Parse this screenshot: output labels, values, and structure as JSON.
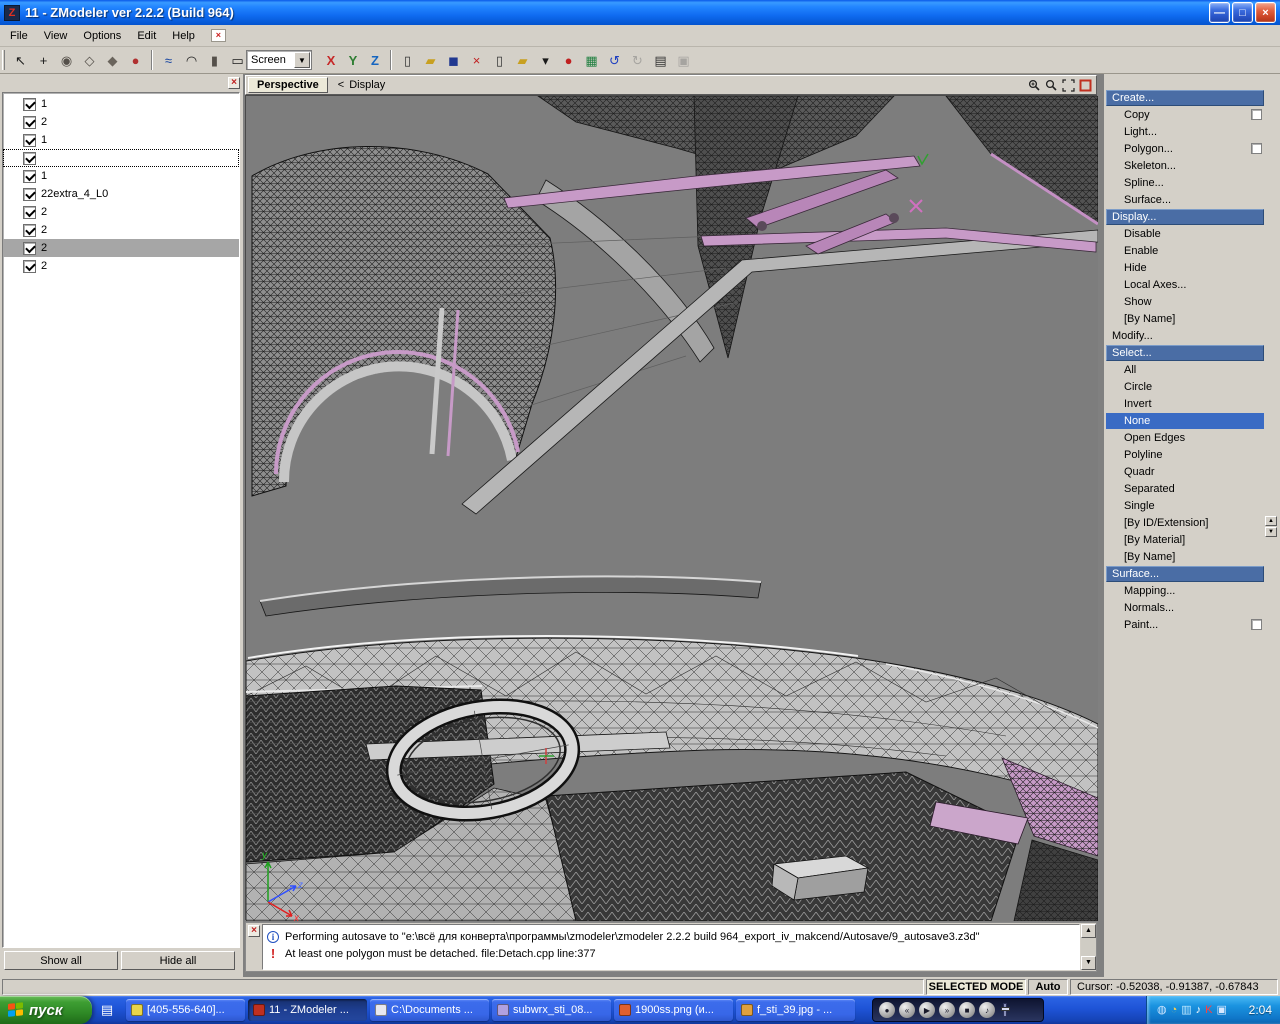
{
  "window": {
    "title": "11 - ZModeler ver 2.2.2 (Build 964)",
    "app_icon_letter": "Z",
    "controls": {
      "minimize": "—",
      "maximize": "□",
      "close": "×"
    }
  },
  "menubar": {
    "items": [
      "File",
      "View",
      "Options",
      "Edit",
      "Help"
    ],
    "decor_glyph": "×"
  },
  "toolbar": {
    "screen_label": "Screen",
    "screen_dropdown_glyph": "▼",
    "axis": [
      {
        "label": "X",
        "color": "#C62828"
      },
      {
        "label": "Y",
        "color": "#2E7D32"
      },
      {
        "label": "Z",
        "color": "#1565C0"
      }
    ],
    "group_a": [
      {
        "name": "select-tool-icon",
        "glyph": "↖",
        "color": "#1a1a1a"
      },
      {
        "name": "move-tool-icon",
        "glyph": "+",
        "color": "#1a1a1a"
      },
      {
        "name": "figure-tool-icon",
        "glyph": "◉",
        "color": "#55504a"
      },
      {
        "name": "bone-tool-icon",
        "glyph": "◇",
        "color": "#55504a"
      },
      {
        "name": "joint-tool-icon",
        "glyph": "◆",
        "color": "#6a645c"
      },
      {
        "name": "sphere-primitive-icon",
        "glyph": "●",
        "color": "#B03030"
      }
    ],
    "group_b": [
      {
        "name": "polyline-tool-icon",
        "glyph": "≈",
        "color": "#1040A0"
      },
      {
        "name": "arc-tool-icon",
        "glyph": "◠",
        "color": "#1a1a1a"
      },
      {
        "name": "cylinder-primitive-icon",
        "glyph": "▮",
        "color": "#55504a"
      },
      {
        "name": "box-primitive-icon",
        "glyph": "▭",
        "color": "#1a1a1a"
      },
      {
        "name": "primitives-dropdown-icon",
        "glyph": "▾",
        "color": "#1a1a1a"
      }
    ],
    "group_c": [
      {
        "name": "new-file-icon",
        "glyph": "▯",
        "color": "#333333"
      },
      {
        "name": "open-file-icon",
        "glyph": "▰",
        "color": "#C8A020"
      },
      {
        "name": "save-file-icon",
        "glyph": "◼",
        "color": "#203890"
      },
      {
        "name": "delete-icon",
        "glyph": "×",
        "color": "#C02020"
      },
      {
        "name": "export-file-icon",
        "glyph": "▯",
        "color": "#333333"
      },
      {
        "name": "import-folder-icon",
        "glyph": "▰",
        "color": "#C8A020"
      },
      {
        "name": "import-dropdown-icon",
        "glyph": "▾",
        "color": "#1a1a1a"
      },
      {
        "name": "record-icon",
        "glyph": "●",
        "color": "#C02020"
      },
      {
        "name": "image-tool-icon",
        "glyph": "▦",
        "color": "#208040"
      },
      {
        "name": "undo-icon",
        "glyph": "↺",
        "color": "#2040C0"
      },
      {
        "name": "redo-icon",
        "glyph": "↻",
        "color": "#707070",
        "disabled": true
      },
      {
        "name": "notes-icon",
        "glyph": "▤",
        "color": "#333333"
      },
      {
        "name": "repeat-icon",
        "glyph": "▣",
        "color": "#707070",
        "disabled": true
      }
    ]
  },
  "left_panel": {
    "items": [
      {
        "label": "1",
        "checked": true,
        "state": "normal"
      },
      {
        "label": "2",
        "checked": true,
        "state": "normal"
      },
      {
        "label": "1",
        "checked": true,
        "state": "normal"
      },
      {
        "label": "",
        "checked": true,
        "state": "focused"
      },
      {
        "label": "1",
        "checked": true,
        "state": "normal"
      },
      {
        "label": "22extra_4_L0",
        "checked": true,
        "state": "normal"
      },
      {
        "label": "2",
        "checked": true,
        "state": "normal"
      },
      {
        "label": "2",
        "checked": true,
        "state": "normal"
      },
      {
        "label": "2",
        "checked": true,
        "state": "selected"
      },
      {
        "label": "2",
        "checked": true,
        "state": "normal"
      }
    ],
    "show_all_button": "Show all",
    "hide_all_button": "Hide all"
  },
  "viewport": {
    "tab_label": "Perspective",
    "back_glyph": "<",
    "display_label": "Display",
    "axis_x": "x",
    "axis_y": "y",
    "axis_z": "z"
  },
  "right_menu": {
    "items": [
      {
        "label": "Create...",
        "type": "header"
      },
      {
        "label": "Copy",
        "type": "item",
        "checkbox": true
      },
      {
        "label": "Light...",
        "type": "item"
      },
      {
        "label": "Polygon...",
        "type": "item",
        "checkbox": true
      },
      {
        "label": "Skeleton...",
        "type": "item"
      },
      {
        "label": "Spline...",
        "type": "item"
      },
      {
        "label": "Surface...",
        "type": "item"
      },
      {
        "label": "Display...",
        "type": "header"
      },
      {
        "label": "Disable",
        "type": "item"
      },
      {
        "label": "Enable",
        "type": "item"
      },
      {
        "label": "Hide",
        "type": "item"
      },
      {
        "label": "Local Axes...",
        "type": "item"
      },
      {
        "label": "Show",
        "type": "item"
      },
      {
        "label": "[By Name]",
        "type": "item"
      },
      {
        "label": "Modify...",
        "type": "plain"
      },
      {
        "label": "Select...",
        "type": "header"
      },
      {
        "label": "All",
        "type": "item"
      },
      {
        "label": "Circle",
        "type": "item"
      },
      {
        "label": "Invert",
        "type": "item"
      },
      {
        "label": "None",
        "type": "item",
        "selected": true
      },
      {
        "label": "Open Edges",
        "type": "item"
      },
      {
        "label": "Polyline",
        "type": "item"
      },
      {
        "label": "Quadr",
        "type": "item"
      },
      {
        "label": "Separated",
        "type": "item"
      },
      {
        "label": "Single",
        "type": "item"
      },
      {
        "label": "[By ID/Extension]",
        "type": "item"
      },
      {
        "label": "[By Material]",
        "type": "item"
      },
      {
        "label": "[By Name]",
        "type": "item"
      },
      {
        "label": "Surface...",
        "type": "header"
      },
      {
        "label": "Mapping...",
        "type": "item"
      },
      {
        "label": "Normals...",
        "type": "item"
      },
      {
        "label": "Paint...",
        "type": "item",
        "checkbox": true
      }
    ],
    "scroll_up_glyph": "▲",
    "scroll_down_glyph": "▼"
  },
  "messages": {
    "line1": "Performing autosave to \"e:\\всё для конверта\\программы\\zmodeler\\zmodeler 2.2.2 build 964_export_iv_makcend/Autosave/9_autosave3.z3d\"",
    "line2": "At least one polygon must be detached. file:Detach.cpp line:377",
    "info_glyph": "i",
    "warn_glyph": "!",
    "scroll_up_glyph": "▲",
    "scroll_down_glyph": "▼"
  },
  "statusbar": {
    "mode": "SELECTED MODE",
    "auto_label": "Auto",
    "cursor": "Cursor: -0.52038, -0.91387, -0.67843"
  },
  "taskbar": {
    "start_label": "пуск",
    "quick_launch_glyph": "▤",
    "buttons": [
      {
        "label": "[405-556-640]...",
        "icon_name": "chat-window-icon",
        "icon_color": "#E8D44A"
      },
      {
        "label": "11 - ZModeler ...",
        "icon_name": "zmodeler-icon",
        "icon_color": "#C03020",
        "active": true
      },
      {
        "label": "C:\\Documents ...",
        "icon_name": "explorer-window-icon",
        "icon_color": "#E8E8F0"
      },
      {
        "label": "subwrx_sti_08...",
        "icon_name": "archive-file-icon",
        "icon_color": "#B0A0E0"
      },
      {
        "label": "1900ss.png (и...",
        "icon_name": "image-file-icon",
        "icon_color": "#E06030"
      },
      {
        "label": "f_sti_39.jpg - ...",
        "icon_name": "image-file-icon",
        "icon_color": "#E0A040"
      }
    ],
    "media_controls": [
      {
        "name": "knob-button",
        "glyph": "●"
      },
      {
        "name": "previous-track-button",
        "glyph": "«"
      },
      {
        "name": "play-pause-button",
        "glyph": "▶"
      },
      {
        "name": "next-track-button",
        "glyph": "»"
      },
      {
        "name": "stop-button",
        "glyph": "■"
      },
      {
        "name": "volume-button",
        "glyph": "♪"
      }
    ],
    "tray_icons": [
      {
        "name": "media-player-tray-icon",
        "glyph": "◍",
        "color": "#CFE6FF"
      },
      {
        "name": "scheduler-tray-icon",
        "glyph": "◔",
        "color": "#FFD24A"
      },
      {
        "name": "network-tray-icon",
        "glyph": "▥",
        "color": "#BFE9FF"
      },
      {
        "name": "volume-tray-icon",
        "glyph": "♪",
        "color": "#FFFFFF"
      },
      {
        "name": "antivirus-tray-icon",
        "glyph": "K",
        "color": "#FF4040"
      },
      {
        "name": "language-tray-icon",
        "glyph": "▣",
        "color": "#D8E8FF"
      }
    ],
    "clock": "2:04"
  }
}
